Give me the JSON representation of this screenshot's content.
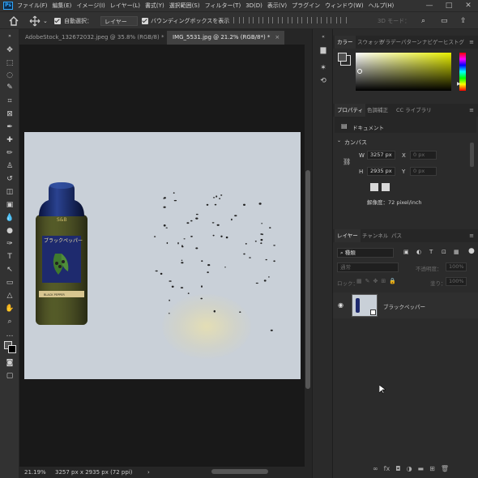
{
  "menubar": {
    "app_icon": "Ps",
    "items": [
      "ファイル(F)",
      "編集(E)",
      "イメージ(I)",
      "レイヤー(L)",
      "書式(Y)",
      "選択範囲(S)",
      "フィルター(T)",
      "3D(D)",
      "表示(V)",
      "プラグイン",
      "ウィンドウ(W)",
      "ヘルプ(H)"
    ],
    "window_controls": [
      "—",
      "□",
      "✕"
    ]
  },
  "options": {
    "auto_select_label": "自動選択：",
    "auto_select_value": "レイヤー",
    "bbox_label": "バウンディングボックスを表示",
    "mode_3d": "3D モード："
  },
  "tabs": [
    {
      "label": "AdobeStock_132672032.jpeg @ 35.8% (RGB/8) *",
      "close": "×",
      "active": false
    },
    {
      "label": "IMG_5531.jpg @ 21.2% (RGB/8*) *",
      "close": "×",
      "active": true
    }
  ],
  "status": {
    "zoom": "21.19%",
    "doc_info": "3257 px x 2935 px (72 ppi)",
    "arrow": "›"
  },
  "color_panel": {
    "tabs": [
      "カラー",
      "スウォッチ",
      "グラデー",
      "パターン",
      "ナビゲー",
      "ヒストグ"
    ],
    "active": "カラー",
    "accent_hue": "#e8ef00"
  },
  "properties_panel": {
    "tabs": [
      "プロパティ",
      "色調補正",
      "CC ライブラリ"
    ],
    "doc_label": "ドキュメント",
    "section": "カンバス",
    "w_label": "W",
    "w_value": "3257 px",
    "h_label": "H",
    "h_value": "2935 px",
    "x_label": "X",
    "x_placeholder": "0 px",
    "y_label": "Y",
    "y_placeholder": "0 px",
    "resolution": "解像度：72 pixel/inch"
  },
  "layers_panel": {
    "tabs": [
      "レイヤー",
      "チャンネル",
      "パス"
    ],
    "filter_label": "種類",
    "blend_mode": "通常",
    "opacity_label": "不透明度：",
    "opacity_value": "100%",
    "lock_label": "ロック：",
    "fill_label": "塗り：",
    "fill_value": "100%",
    "layer_name": "ブラックペッパー"
  },
  "jar": {
    "brand": "S&B",
    "title": "ブラックペッパー",
    "subtitle": "BLACK PEPPER"
  }
}
